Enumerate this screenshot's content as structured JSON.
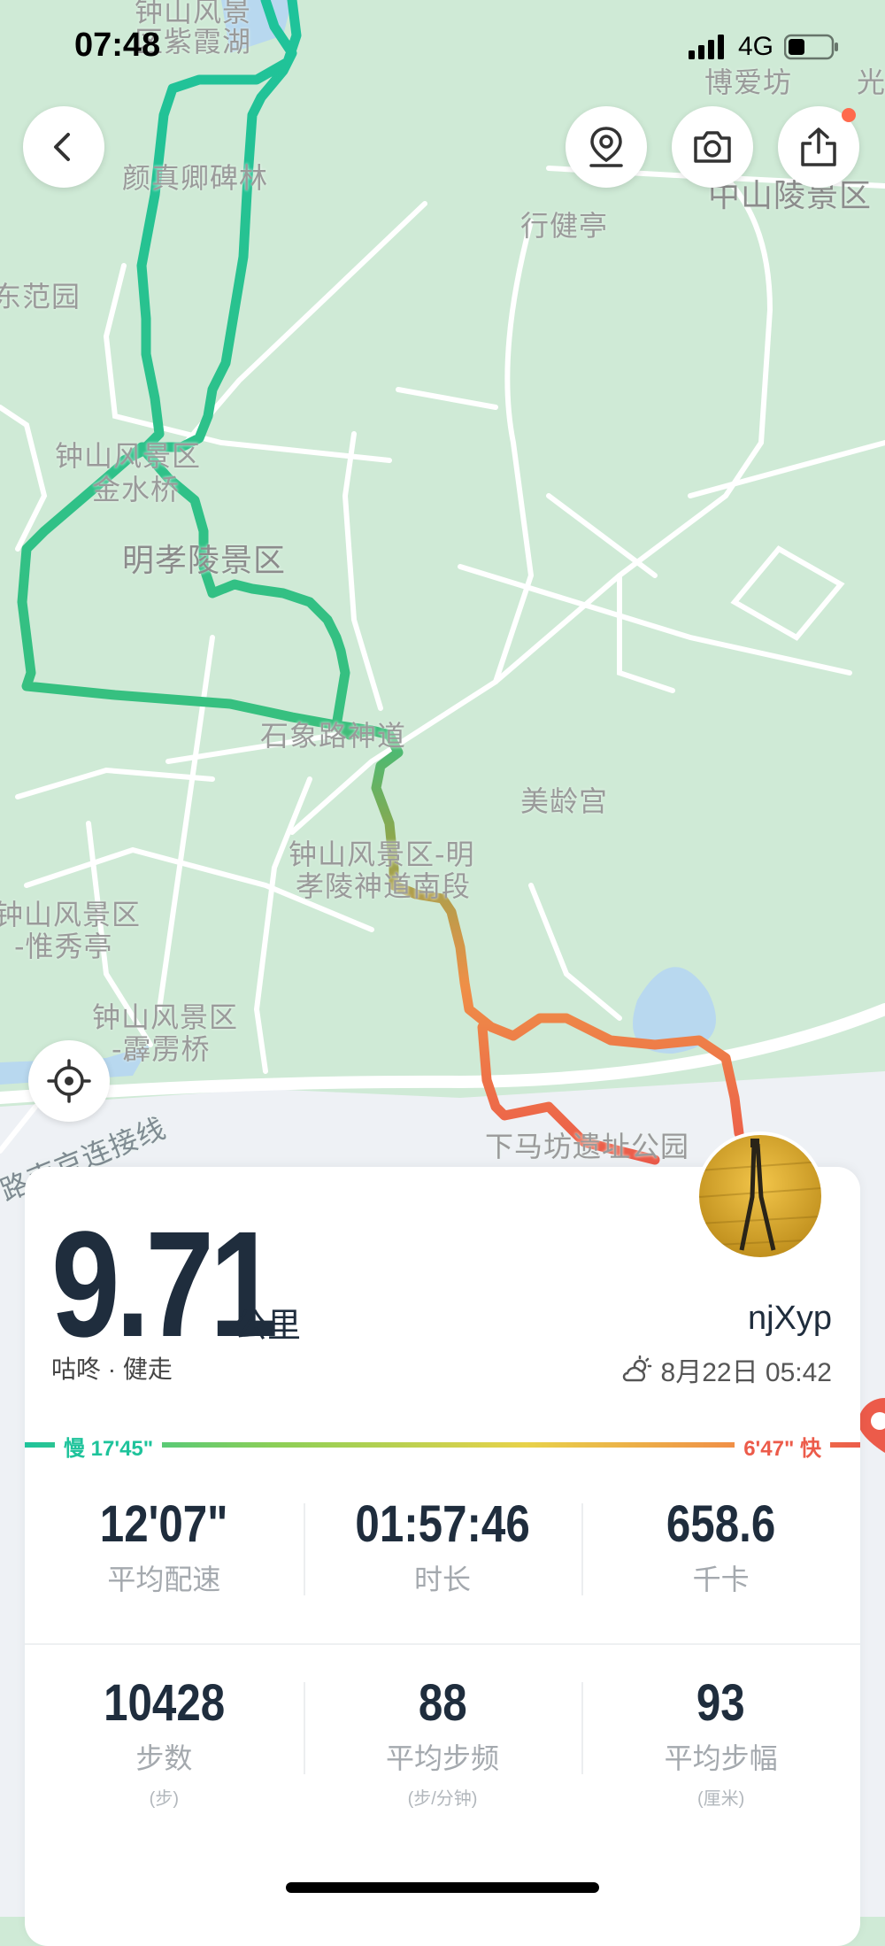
{
  "status": {
    "time": "07:48",
    "network": "4G"
  },
  "map": {
    "labels": [
      {
        "text": "钟山风景",
        "cls": ""
      },
      {
        "text": "区紫霞湖",
        "cls": ""
      },
      {
        "text": "博爱坊",
        "cls": ""
      },
      {
        "text": "光",
        "cls": ""
      },
      {
        "text": "颜真卿碑林",
        "cls": ""
      },
      {
        "text": "中山陵景区",
        "cls": "big"
      },
      {
        "text": "行健亭",
        "cls": ""
      },
      {
        "text": "东范园",
        "cls": ""
      },
      {
        "text": "钟山风景区",
        "cls": ""
      },
      {
        "text": "金水桥",
        "cls": ""
      },
      {
        "text": "明孝陵景区",
        "cls": "big"
      },
      {
        "text": "石象路神道",
        "cls": ""
      },
      {
        "text": "美龄宫",
        "cls": ""
      },
      {
        "text": "钟山风景区-明",
        "cls": ""
      },
      {
        "text": "孝陵神道南段",
        "cls": ""
      },
      {
        "text": "钟山风景区",
        "cls": ""
      },
      {
        "text": "-惟秀亭",
        "cls": ""
      },
      {
        "text": "钟山风景区",
        "cls": ""
      },
      {
        "text": "-霹雳桥",
        "cls": ""
      },
      {
        "text": "下马坊遗址公园",
        "cls": ""
      },
      {
        "text": "路南京连接线",
        "cls": "road"
      }
    ]
  },
  "buttons": {
    "back": "back",
    "location": "map-pin",
    "camera": "camera",
    "share": "share"
  },
  "workout": {
    "distance": "9.71",
    "unit": "公里",
    "activity": "咕咚 · 健走",
    "username": "njXyp",
    "datetime": "8月22日 05:42",
    "pace_slow": "慢 17'45\"",
    "pace_fast": "6'47\" 快"
  },
  "stats_row1": [
    {
      "value": "12'07\"",
      "label": "平均配速"
    },
    {
      "value": "01:57:46",
      "label": "时长"
    },
    {
      "value": "658.6",
      "label": "千卡"
    }
  ],
  "stats_row2": [
    {
      "value": "10428",
      "label": "步数",
      "sub": "(步)"
    },
    {
      "value": "88",
      "label": "平均步频",
      "sub": "(步/分钟)"
    },
    {
      "value": "93",
      "label": "平均步幅",
      "sub": "(厘米)"
    }
  ],
  "colors": {
    "route_start": "#1ec39b",
    "route_end": "#ec5b4a",
    "map_bg": "#cfead6"
  }
}
